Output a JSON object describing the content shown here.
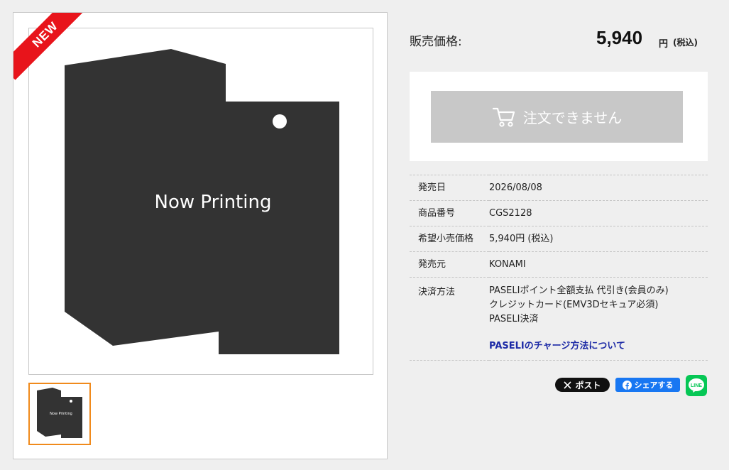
{
  "badge": {
    "new": "NEW"
  },
  "image": {
    "placeholder_text": "Now Printing"
  },
  "price": {
    "label": "販売価格:",
    "value": "5,940",
    "currency": "円",
    "tax": "(税込)"
  },
  "order": {
    "button_label": "注文できません",
    "icon": "cart-icon"
  },
  "specs": {
    "release_date": {
      "key": "発売日",
      "value": "2026/08/08"
    },
    "product_number": {
      "key": "商品番号",
      "value": "CGS2128"
    },
    "msrp": {
      "key": "希望小売価格",
      "value": "5,940円 (税込)"
    },
    "publisher": {
      "key": "発売元",
      "value": "KONAMI"
    },
    "payment": {
      "key": "決済方法",
      "lines": [
        "PASELIポイント全額支払 代引き(会員のみ)",
        "クレジットカード(EMV3Dセキュア必須)",
        "PASELI決済"
      ],
      "link": "PASELIのチャージ方法について"
    }
  },
  "share": {
    "x_label": "ポスト",
    "facebook_label": "シェアする",
    "line_label": "LINE"
  },
  "colors": {
    "new_badge": "#e8141b",
    "thumb_border": "#f08a1c",
    "disabled_button": "#c8c8c8",
    "link": "#1c2aa6",
    "line": "#06c755",
    "facebook": "#1877f2"
  }
}
